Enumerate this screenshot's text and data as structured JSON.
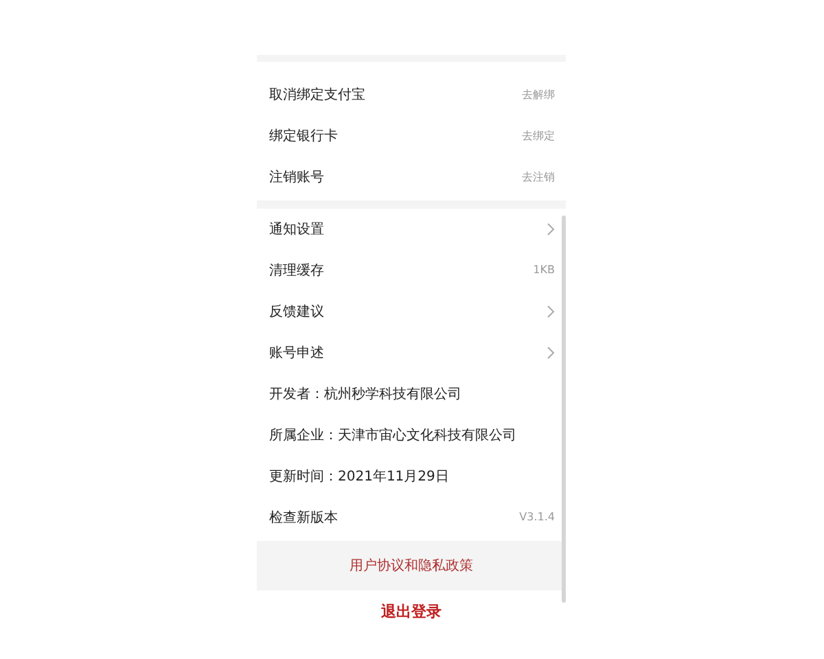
{
  "account_rows": [
    {
      "label": "取消绑定支付宝",
      "value": "去解绑"
    },
    {
      "label": "绑定银行卡",
      "value": "去绑定"
    },
    {
      "label": "注销账号",
      "value": "去注销"
    }
  ],
  "settings_rows": [
    {
      "kind": "chevron",
      "label": "通知设置"
    },
    {
      "kind": "value",
      "label": "清理缓存",
      "value": "1KB"
    },
    {
      "kind": "chevron",
      "label": "反馈建议"
    },
    {
      "kind": "chevron",
      "label": "账号申述"
    },
    {
      "kind": "info",
      "label": "开发者：杭州秒学科技有限公司"
    },
    {
      "kind": "info",
      "label": "所属企业：天津市宙心文化科技有限公司"
    },
    {
      "kind": "info",
      "label": "更新时间：2021年11月29日"
    },
    {
      "kind": "value",
      "label": "检查新版本",
      "value": "V3.1.4"
    }
  ],
  "policy_link": "用户协议和隐私政策",
  "logout_button": "退出登录"
}
